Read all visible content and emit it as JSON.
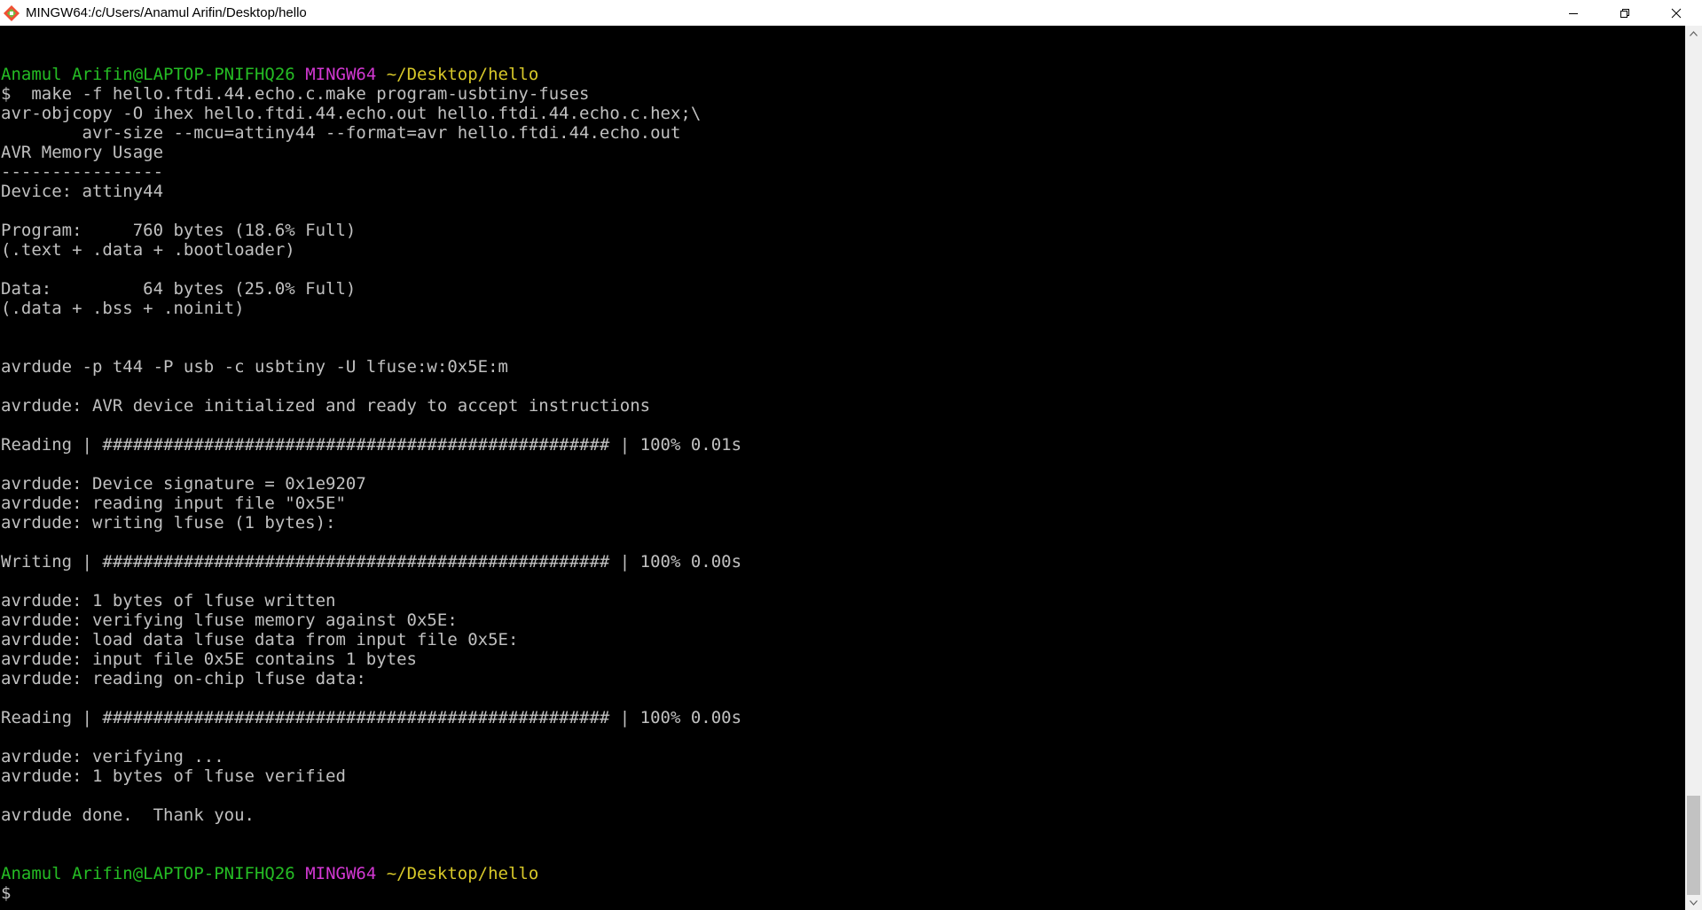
{
  "window": {
    "title": "MINGW64:/c/Users/Anamul Arifin/Desktop/hello",
    "controls": {
      "minimize": "minimize-icon",
      "maximize": "restore-icon",
      "close": "close-icon"
    }
  },
  "colors": {
    "background": "#000000",
    "text": "#c0c0c0",
    "prompt_user": "#25bc24",
    "prompt_env": "#d338d3",
    "prompt_path": "#d7c829"
  },
  "prompt": {
    "user": "Anamul Arifin@LAPTOP-PNIFHQ26",
    "env": "MINGW64",
    "path": "~/Desktop/hello",
    "symbol": "$"
  },
  "command": "$  make -f hello.ftdi.44.echo.c.make program-usbtiny-fuses",
  "output": [
    "avr-objcopy -O ihex hello.ftdi.44.echo.out hello.ftdi.44.echo.c.hex;\\",
    "        avr-size --mcu=attiny44 --format=avr hello.ftdi.44.echo.out",
    "AVR Memory Usage",
    "----------------",
    "Device: attiny44",
    "",
    "Program:     760 bytes (18.6% Full)",
    "(.text + .data + .bootloader)",
    "",
    "Data:         64 bytes (25.0% Full)",
    "(.data + .bss + .noinit)",
    "",
    "",
    "avrdude -p t44 -P usb -c usbtiny -U lfuse:w:0x5E:m",
    "",
    "avrdude: AVR device initialized and ready to accept instructions",
    "",
    "Reading | ################################################## | 100% 0.01s",
    "",
    "avrdude: Device signature = 0x1e9207",
    "avrdude: reading input file \"0x5E\"",
    "avrdude: writing lfuse (1 bytes):",
    "",
    "Writing | ################################################## | 100% 0.00s",
    "",
    "avrdude: 1 bytes of lfuse written",
    "avrdude: verifying lfuse memory against 0x5E:",
    "avrdude: load data lfuse data from input file 0x5E:",
    "avrdude: input file 0x5E contains 1 bytes",
    "avrdude: reading on-chip lfuse data:",
    "",
    "Reading | ################################################## | 100% 0.00s",
    "",
    "avrdude: verifying ...",
    "avrdude: 1 bytes of lfuse verified",
    "",
    "avrdude done.  Thank you.",
    "",
    ""
  ]
}
